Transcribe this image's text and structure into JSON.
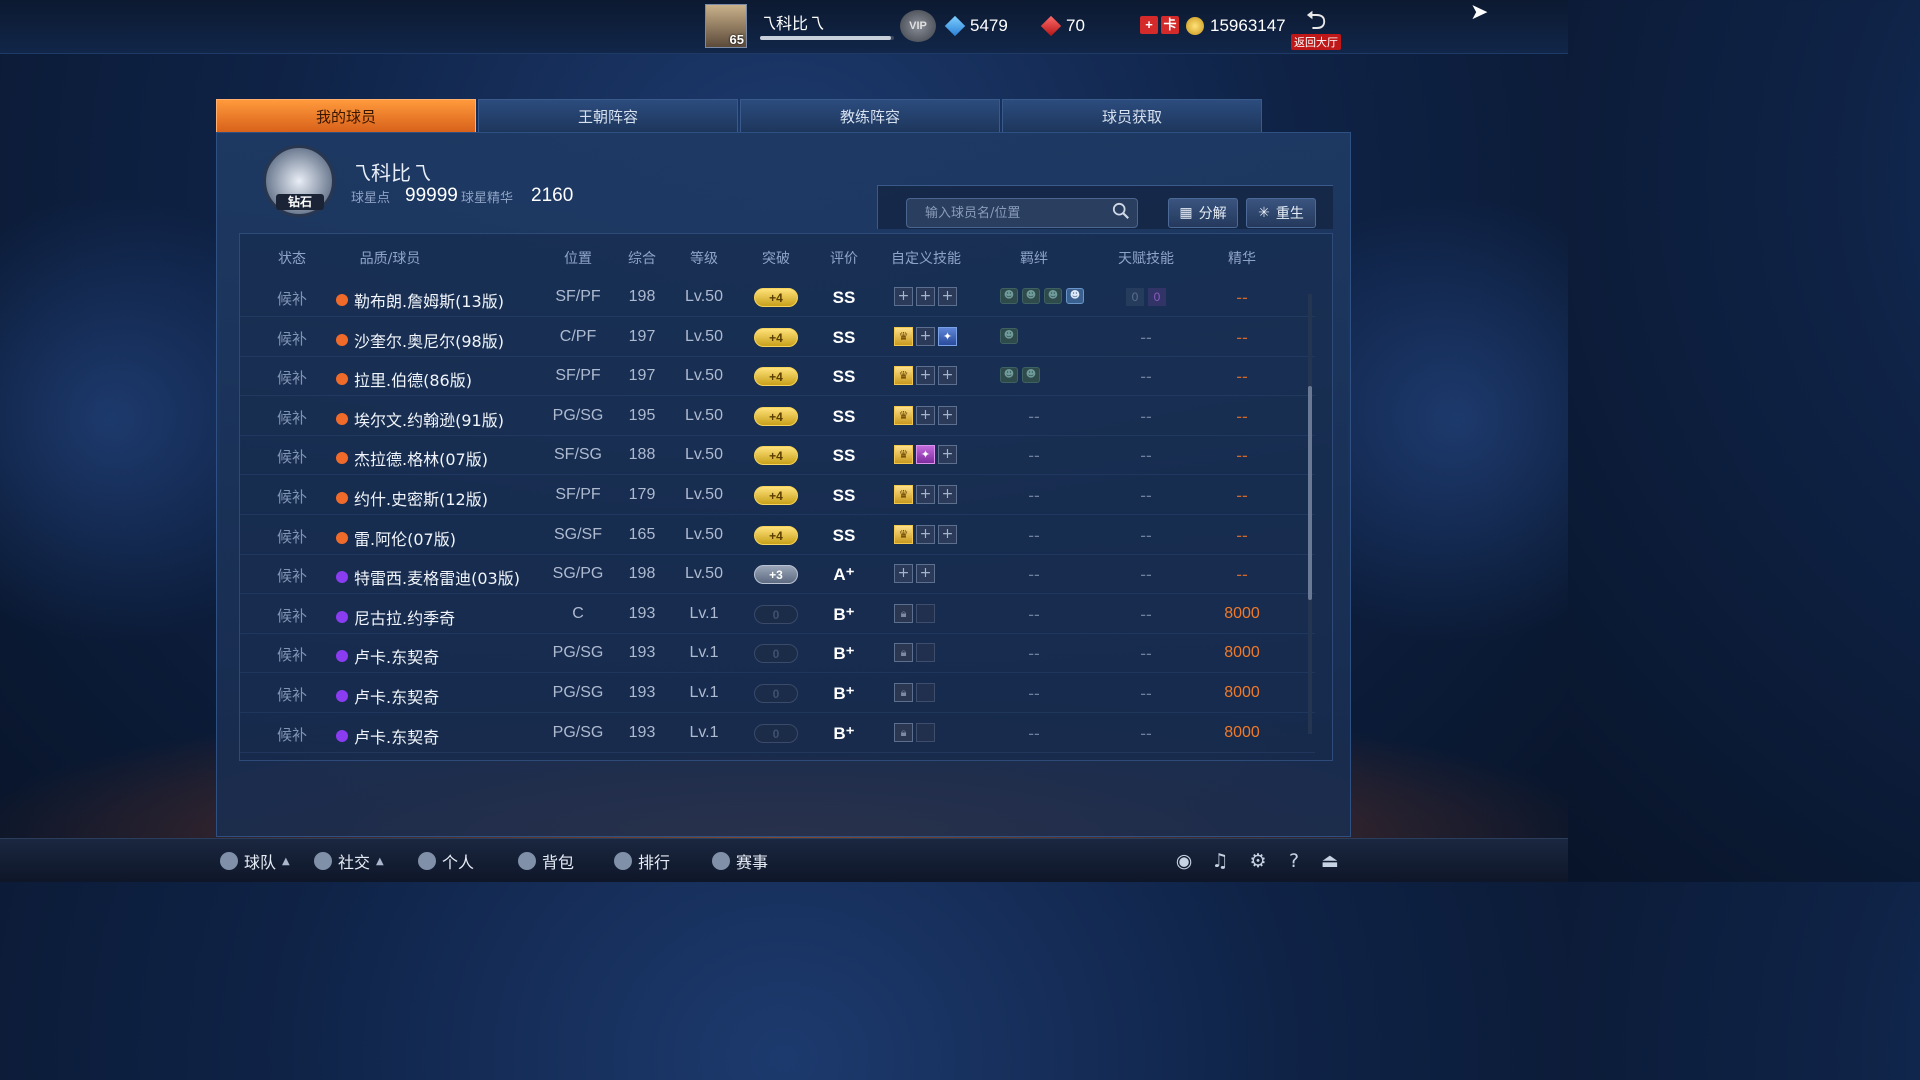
{
  "topbar": {
    "user_name": "乁科比乁",
    "avatar_level": "65",
    "exp_fraction": 0.98,
    "vip_label": "VIP",
    "diamonds": "5479",
    "rubies": "70",
    "red_box_icons": [
      "+",
      "卡"
    ],
    "gold": "15963147",
    "back_label": "返回大厅"
  },
  "tabs": [
    {
      "label": "我的球员",
      "active": true
    },
    {
      "label": "王朝阵容",
      "active": false
    },
    {
      "label": "教练阵容",
      "active": false
    },
    {
      "label": "球员获取",
      "active": false
    }
  ],
  "profile": {
    "rank_label": "钻石",
    "name": "乁科比乁",
    "star_points_label": "球星点",
    "star_points": "99999",
    "essence_label": "球星精华",
    "essence": "2160"
  },
  "search": {
    "placeholder": "输入球员名/位置",
    "decompose_label": "分解",
    "rebirth_label": "重生"
  },
  "table": {
    "headers": {
      "status": "状态",
      "name": "品质/球员",
      "position": "位置",
      "overall": "综合",
      "level": "等级",
      "breakthrough": "突破",
      "grade": "评价",
      "custom_skill": "自定义技能",
      "bond": "羁绊",
      "talent": "天赋技能",
      "essence": "精华"
    },
    "rows": [
      {
        "status": "候补",
        "quality": "orange",
        "name": "勒布朗.詹姆斯(13版)",
        "position": "SF/PF",
        "overall": "198",
        "level": "Lv.50",
        "break": "+4",
        "break_style": "gold",
        "grade": "SS",
        "skills": [
          "+",
          "+",
          "+"
        ],
        "bond": [
          "b",
          "b",
          "b",
          "hl"
        ],
        "talent": [
          "0",
          "0"
        ],
        "essence": "--"
      },
      {
        "status": "候补",
        "quality": "orange",
        "name": "沙奎尔.奥尼尔(98版)",
        "position": "C/PF",
        "overall": "197",
        "level": "Lv.50",
        "break": "+4",
        "break_style": "gold",
        "grade": "SS",
        "skills": [
          "crown",
          "+",
          "blue"
        ],
        "bond": [
          "b"
        ],
        "talent_text": "--",
        "essence": "--"
      },
      {
        "status": "候补",
        "quality": "orange",
        "name": "拉里.伯德(86版)",
        "position": "SF/PF",
        "overall": "197",
        "level": "Lv.50",
        "break": "+4",
        "break_style": "gold",
        "grade": "SS",
        "skills": [
          "crown",
          "+",
          "+"
        ],
        "bond": [
          "b",
          "b"
        ],
        "talent_text": "--",
        "essence": "--"
      },
      {
        "status": "候补",
        "quality": "orange",
        "name": "埃尔文.约翰逊(91版)",
        "position": "PG/SG",
        "overall": "195",
        "level": "Lv.50",
        "break": "+4",
        "break_style": "gold",
        "grade": "SS",
        "skills": [
          "crown",
          "+",
          "+"
        ],
        "bond_text": "--",
        "talent_text": "--",
        "essence": "--"
      },
      {
        "status": "候补",
        "quality": "orange",
        "name": "杰拉德.格林(07版)",
        "position": "SF/SG",
        "overall": "188",
        "level": "Lv.50",
        "break": "+4",
        "break_style": "gold",
        "grade": "SS",
        "skills": [
          "crown",
          "purple",
          "+"
        ],
        "bond_text": "--",
        "talent_text": "--",
        "essence": "--"
      },
      {
        "status": "候补",
        "quality": "orange",
        "name": "约什.史密斯(12版)",
        "position": "SF/PF",
        "overall": "179",
        "level": "Lv.50",
        "break": "+4",
        "break_style": "gold",
        "grade": "SS",
        "skills": [
          "crown",
          "+",
          "+"
        ],
        "bond_text": "--",
        "talent_text": "--",
        "essence": "--"
      },
      {
        "status": "候补",
        "quality": "orange",
        "name": "雷.阿伦(07版)",
        "position": "SG/SF",
        "overall": "165",
        "level": "Lv.50",
        "break": "+4",
        "break_style": "gold",
        "grade": "SS",
        "skills": [
          "crown",
          "+",
          "+"
        ],
        "bond_text": "--",
        "talent_text": "--",
        "essence": "--"
      },
      {
        "status": "候补",
        "quality": "purple",
        "name": "特雷西.麦格雷迪(03版)",
        "position": "SG/PG",
        "overall": "198",
        "level": "Lv.50",
        "break": "+3",
        "break_style": "silver",
        "grade": "A⁺",
        "skills": [
          "+",
          "+"
        ],
        "bond_text": "--",
        "talent_text": "--",
        "essence": "--"
      },
      {
        "status": "候补",
        "quality": "purple",
        "name": "尼古拉.约季奇",
        "position": "C",
        "overall": "193",
        "level": "Lv.1",
        "break": "0",
        "break_style": "empty",
        "grade": "B⁺",
        "skills": [
          "lock",
          "blank"
        ],
        "bond_text": "--",
        "talent_text": "--",
        "essence": "8000"
      },
      {
        "status": "候补",
        "quality": "purple",
        "name": "卢卡.东契奇",
        "position": "PG/SG",
        "overall": "193",
        "level": "Lv.1",
        "break": "0",
        "break_style": "empty",
        "grade": "B⁺",
        "skills": [
          "lock",
          "blank"
        ],
        "bond_text": "--",
        "talent_text": "--",
        "essence": "8000"
      },
      {
        "status": "候补",
        "quality": "purple",
        "name": "卢卡.东契奇",
        "position": "PG/SG",
        "overall": "193",
        "level": "Lv.1",
        "break": "0",
        "break_style": "empty",
        "grade": "B⁺",
        "skills": [
          "lock",
          "blank"
        ],
        "bond_text": "--",
        "talent_text": "--",
        "essence": "8000"
      },
      {
        "status": "候补",
        "quality": "purple",
        "name": "卢卡.东契奇",
        "position": "PG/SG",
        "overall": "193",
        "level": "Lv.1",
        "break": "0",
        "break_style": "empty",
        "grade": "B⁺",
        "skills": [
          "lock",
          "blank"
        ],
        "bond_text": "--",
        "talent_text": "--",
        "essence": "8000"
      }
    ]
  },
  "colors": {
    "quality_orange": "#f06a2a",
    "quality_purple": "#8a3cf0",
    "tab_active": "#ff9a3c",
    "essence_value": "#f07a2a"
  },
  "bottom_nav": [
    {
      "label": "球队",
      "icon": "person-icon",
      "caret": true
    },
    {
      "label": "社交",
      "icon": "heart-icon",
      "caret": true
    },
    {
      "label": "个人",
      "icon": "person-icon",
      "caret": false
    },
    {
      "label": "背包",
      "icon": "bag-icon",
      "caret": false
    },
    {
      "label": "排行",
      "icon": "flame-icon",
      "caret": false
    },
    {
      "label": "赛事",
      "icon": "trophy-icon",
      "caret": false
    }
  ],
  "bottom_icons": [
    "headset-icon",
    "music-icon",
    "gear-icon",
    "help-icon",
    "exit-icon"
  ]
}
